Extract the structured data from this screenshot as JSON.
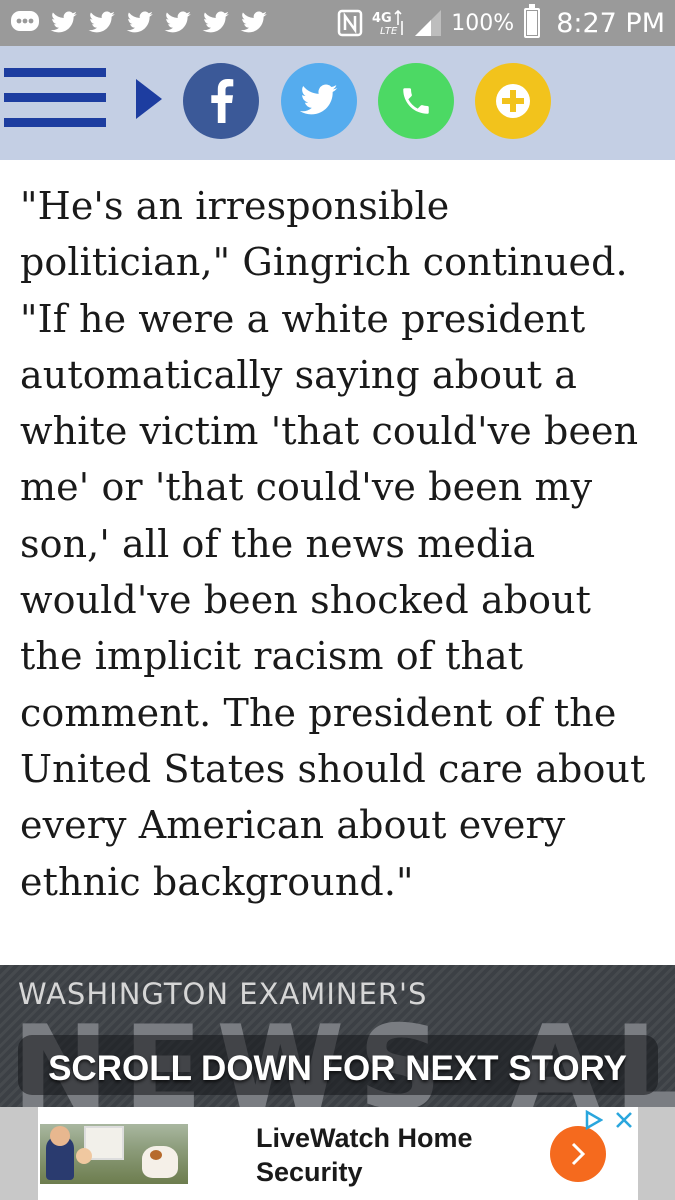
{
  "status_bar": {
    "notification_icons": [
      "chat-bubble-icon",
      "twitter-icon",
      "twitter-icon",
      "twitter-icon",
      "twitter-icon",
      "twitter-icon",
      "twitter-icon",
      "nfc-icon"
    ],
    "network": "4G LTE",
    "battery": "100%",
    "time": "8:27 PM"
  },
  "share_bar": {
    "background": "#c4cfe4",
    "buttons": [
      "facebook",
      "twitter",
      "phone",
      "more"
    ]
  },
  "article": {
    "paragraph": "\"He's an irresponsible politician,\" Gingrich continued. \"If he were a white president automatically saying about a white victim 'that could've been me' or 'that could've been my son,' all of the news media would've been shocked about the implicit racism of that comment. The president of the United States should care about every American about every ethnic background.\""
  },
  "news_alert": {
    "kicker": "WASHINGTON EXAMINER'S",
    "big_text": "NEWS ALERT",
    "cta": "SCROLL DOWN FOR NEXT STORY"
  },
  "ad": {
    "title": "LiveWatch Home Security",
    "accent": "#f56a1e"
  }
}
